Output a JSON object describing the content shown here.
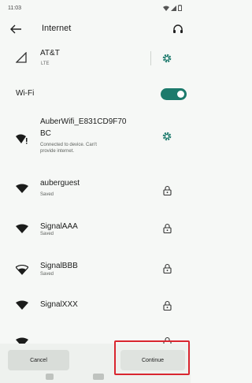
{
  "status": {
    "time": "11:03"
  },
  "header": {
    "title": "Internet"
  },
  "carrier": {
    "name": "AT&T",
    "type": "LTE"
  },
  "wifi": {
    "label": "Wi-Fi",
    "enabled": true,
    "accent": "#1c7a6c"
  },
  "networks": [
    {
      "name": "AuberWifi_E831CD9F70",
      "name2": "BC",
      "status1": "Connected to device. Can't",
      "status2": "provide internet.",
      "trailing": "gear-icon"
    },
    {
      "name": "auberguest",
      "status": "Saved",
      "trailing": "lock-icon"
    },
    {
      "name": "SignalAAA",
      "status": "Saved",
      "trailing": "lock-icon"
    },
    {
      "name": "SignalBBB",
      "status": "Saved",
      "trailing": "lock-icon"
    },
    {
      "name": "SignalXXX",
      "status": "",
      "trailing": "lock-icon"
    }
  ],
  "actions": {
    "cancel": "Cancel",
    "continue": "Continue"
  },
  "highlight_color": "#d9262f"
}
